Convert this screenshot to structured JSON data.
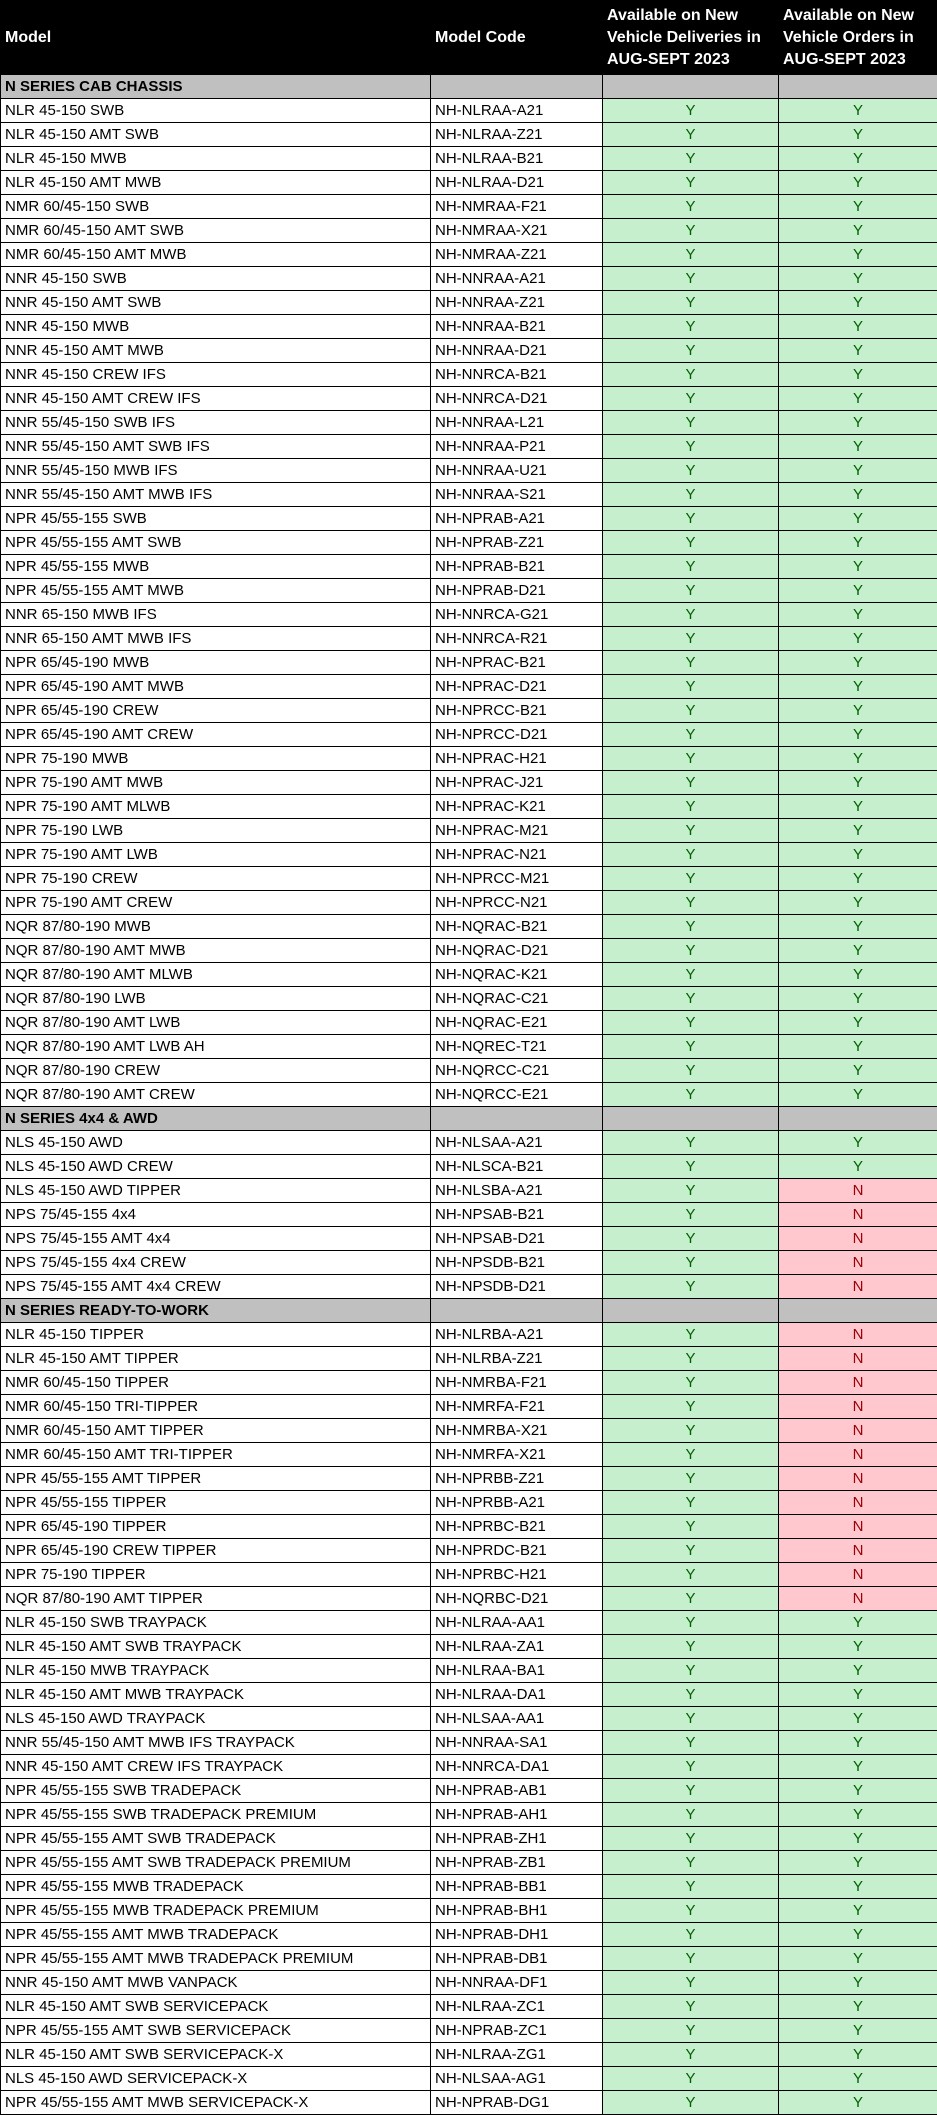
{
  "headers": {
    "model": "Model",
    "code": "Model Code",
    "deliveries": "Available on New Vehicle Deliveries in AUG-SEPT 2023",
    "orders": "Available on New Vehicle Orders in AUG-SEPT 2023"
  },
  "colors": {
    "header_bg": "#000000",
    "section_bg": "#c0c0c0",
    "yes_bg": "#c6efce",
    "yes_text": "#006100",
    "no_bg": "#ffc7ce",
    "no_text": "#9c0006"
  },
  "rows": [
    {
      "type": "section",
      "title": "N SERIES CAB CHASSIS"
    },
    {
      "type": "row",
      "model": "NLR 45-150 SWB",
      "code": "NH-NLRAA-A21",
      "deliveries": "Y",
      "orders": "Y"
    },
    {
      "type": "row",
      "model": "NLR 45-150 AMT SWB",
      "code": "NH-NLRAA-Z21",
      "deliveries": "Y",
      "orders": "Y"
    },
    {
      "type": "row",
      "model": "NLR 45-150 MWB",
      "code": "NH-NLRAA-B21",
      "deliveries": "Y",
      "orders": "Y"
    },
    {
      "type": "row",
      "model": "NLR 45-150 AMT MWB",
      "code": "NH-NLRAA-D21",
      "deliveries": "Y",
      "orders": "Y"
    },
    {
      "type": "row",
      "model": "NMR 60/45-150 SWB",
      "code": "NH-NMRAA-F21",
      "deliveries": "Y",
      "orders": "Y"
    },
    {
      "type": "row",
      "model": "NMR 60/45-150 AMT SWB",
      "code": "NH-NMRAA-X21",
      "deliveries": "Y",
      "orders": "Y"
    },
    {
      "type": "row",
      "model": "NMR 60/45-150 AMT MWB",
      "code": "NH-NMRAA-Z21",
      "deliveries": "Y",
      "orders": "Y"
    },
    {
      "type": "row",
      "model": "NNR 45-150 SWB",
      "code": "NH-NNRAA-A21",
      "deliveries": "Y",
      "orders": "Y"
    },
    {
      "type": "row",
      "model": "NNR 45-150 AMT SWB",
      "code": "NH-NNRAA-Z21",
      "deliveries": "Y",
      "orders": "Y"
    },
    {
      "type": "row",
      "model": "NNR 45-150 MWB",
      "code": "NH-NNRAA-B21",
      "deliveries": "Y",
      "orders": "Y"
    },
    {
      "type": "row",
      "model": "NNR 45-150 AMT MWB",
      "code": "NH-NNRAA-D21",
      "deliveries": "Y",
      "orders": "Y"
    },
    {
      "type": "row",
      "model": "NNR 45-150 CREW IFS",
      "code": "NH-NNRCA-B21",
      "deliveries": "Y",
      "orders": "Y"
    },
    {
      "type": "row",
      "model": "NNR 45-150 AMT CREW IFS",
      "code": "NH-NNRCA-D21",
      "deliveries": "Y",
      "orders": "Y"
    },
    {
      "type": "row",
      "model": "NNR 55/45-150 SWB IFS",
      "code": "NH-NNRAA-L21",
      "deliveries": "Y",
      "orders": "Y"
    },
    {
      "type": "row",
      "model": "NNR 55/45-150 AMT SWB IFS",
      "code": "NH-NNRAA-P21",
      "deliveries": "Y",
      "orders": "Y"
    },
    {
      "type": "row",
      "model": "NNR 55/45-150 MWB IFS",
      "code": "NH-NNRAA-U21",
      "deliveries": "Y",
      "orders": "Y"
    },
    {
      "type": "row",
      "model": "NNR 55/45-150 AMT MWB IFS",
      "code": "NH-NNRAA-S21",
      "deliveries": "Y",
      "orders": "Y"
    },
    {
      "type": "row",
      "model": "NPR 45/55-155 SWB",
      "code": "NH-NPRAB-A21",
      "deliveries": "Y",
      "orders": "Y"
    },
    {
      "type": "row",
      "model": "NPR 45/55-155 AMT SWB",
      "code": "NH-NPRAB-Z21",
      "deliveries": "Y",
      "orders": "Y"
    },
    {
      "type": "row",
      "model": "NPR 45/55-155 MWB",
      "code": "NH-NPRAB-B21",
      "deliveries": "Y",
      "orders": "Y"
    },
    {
      "type": "row",
      "model": "NPR 45/55-155 AMT MWB",
      "code": "NH-NPRAB-D21",
      "deliveries": "Y",
      "orders": "Y"
    },
    {
      "type": "row",
      "model": "NNR 65-150 MWB IFS",
      "code": "NH-NNRCA-G21",
      "deliveries": "Y",
      "orders": "Y"
    },
    {
      "type": "row",
      "model": "NNR 65-150 AMT MWB IFS",
      "code": "NH-NNRCA-R21",
      "deliveries": "Y",
      "orders": "Y"
    },
    {
      "type": "row",
      "model": "NPR 65/45-190 MWB",
      "code": "NH-NPRAC-B21",
      "deliveries": "Y",
      "orders": "Y"
    },
    {
      "type": "row",
      "model": "NPR 65/45-190 AMT MWB",
      "code": "NH-NPRAC-D21",
      "deliveries": "Y",
      "orders": "Y"
    },
    {
      "type": "row",
      "model": "NPR 65/45-190 CREW",
      "code": "NH-NPRCC-B21",
      "deliveries": "Y",
      "orders": "Y"
    },
    {
      "type": "row",
      "model": "NPR 65/45-190 AMT CREW",
      "code": "NH-NPRCC-D21",
      "deliveries": "Y",
      "orders": "Y"
    },
    {
      "type": "row",
      "model": "NPR 75-190 MWB",
      "code": "NH-NPRAC-H21",
      "deliveries": "Y",
      "orders": "Y"
    },
    {
      "type": "row",
      "model": "NPR 75-190 AMT MWB",
      "code": "NH-NPRAC-J21",
      "deliveries": "Y",
      "orders": "Y"
    },
    {
      "type": "row",
      "model": "NPR 75-190 AMT MLWB",
      "code": "NH-NPRAC-K21",
      "deliveries": "Y",
      "orders": "Y"
    },
    {
      "type": "row",
      "model": "NPR 75-190 LWB",
      "code": "NH-NPRAC-M21",
      "deliveries": "Y",
      "orders": "Y"
    },
    {
      "type": "row",
      "model": "NPR 75-190 AMT LWB",
      "code": "NH-NPRAC-N21",
      "deliveries": "Y",
      "orders": "Y"
    },
    {
      "type": "row",
      "model": "NPR 75-190 CREW",
      "code": "NH-NPRCC-M21",
      "deliveries": "Y",
      "orders": "Y"
    },
    {
      "type": "row",
      "model": "NPR 75-190 AMT CREW",
      "code": "NH-NPRCC-N21",
      "deliveries": "Y",
      "orders": "Y"
    },
    {
      "type": "row",
      "model": "NQR 87/80-190 MWB",
      "code": "NH-NQRAC-B21",
      "deliveries": "Y",
      "orders": "Y"
    },
    {
      "type": "row",
      "model": "NQR 87/80-190 AMT MWB",
      "code": "NH-NQRAC-D21",
      "deliveries": "Y",
      "orders": "Y"
    },
    {
      "type": "row",
      "model": "NQR 87/80-190 AMT MLWB",
      "code": "NH-NQRAC-K21",
      "deliveries": "Y",
      "orders": "Y"
    },
    {
      "type": "row",
      "model": "NQR 87/80-190 LWB",
      "code": "NH-NQRAC-C21",
      "deliveries": "Y",
      "orders": "Y"
    },
    {
      "type": "row",
      "model": "NQR 87/80-190 AMT LWB",
      "code": "NH-NQRAC-E21",
      "deliveries": "Y",
      "orders": "Y"
    },
    {
      "type": "row",
      "model": "NQR 87/80-190 AMT LWB AH",
      "code": "NH-NQREC-T21",
      "deliveries": "Y",
      "orders": "Y"
    },
    {
      "type": "row",
      "model": "NQR 87/80-190 CREW",
      "code": "NH-NQRCC-C21",
      "deliveries": "Y",
      "orders": "Y"
    },
    {
      "type": "row",
      "model": "NQR 87/80-190 AMT CREW",
      "code": "NH-NQRCC-E21",
      "deliveries": "Y",
      "orders": "Y"
    },
    {
      "type": "section",
      "title": "N SERIES 4x4 & AWD"
    },
    {
      "type": "row",
      "model": "NLS 45-150 AWD",
      "code": "NH-NLSAA-A21",
      "deliveries": "Y",
      "orders": "Y"
    },
    {
      "type": "row",
      "model": "NLS 45-150 AWD CREW",
      "code": "NH-NLSCA-B21",
      "deliveries": "Y",
      "orders": "Y"
    },
    {
      "type": "row",
      "model": "NLS 45-150 AWD TIPPER",
      "code": "NH-NLSBA-A21",
      "deliveries": "Y",
      "orders": "N"
    },
    {
      "type": "row",
      "model": "NPS 75/45-155 4x4",
      "code": "NH-NPSAB-B21",
      "deliveries": "Y",
      "orders": "N"
    },
    {
      "type": "row",
      "model": "NPS 75/45-155 AMT 4x4",
      "code": "NH-NPSAB-D21",
      "deliveries": "Y",
      "orders": "N"
    },
    {
      "type": "row",
      "model": "NPS 75/45-155 4x4 CREW",
      "code": "NH-NPSDB-B21",
      "deliveries": "Y",
      "orders": "N"
    },
    {
      "type": "row",
      "model": "NPS 75/45-155 AMT 4x4 CREW",
      "code": "NH-NPSDB-D21",
      "deliveries": "Y",
      "orders": "N"
    },
    {
      "type": "section",
      "title": "N SERIES READY-TO-WORK"
    },
    {
      "type": "row",
      "model": "NLR 45-150 TIPPER",
      "code": "NH-NLRBA-A21",
      "deliveries": "Y",
      "orders": "N"
    },
    {
      "type": "row",
      "model": "NLR 45-150 AMT TIPPER",
      "code": "NH-NLRBA-Z21",
      "deliveries": "Y",
      "orders": "N"
    },
    {
      "type": "row",
      "model": "NMR 60/45-150 TIPPER",
      "code": "NH-NMRBA-F21",
      "deliveries": "Y",
      "orders": "N"
    },
    {
      "type": "row",
      "model": "NMR 60/45-150 TRI-TIPPER",
      "code": "NH-NMRFA-F21",
      "deliveries": "Y",
      "orders": "N"
    },
    {
      "type": "row",
      "model": "NMR 60/45-150 AMT TIPPER",
      "code": "NH-NMRBA-X21",
      "deliveries": "Y",
      "orders": "N"
    },
    {
      "type": "row",
      "model": "NMR 60/45-150 AMT TRI-TIPPER",
      "code": "NH-NMRFA-X21",
      "deliveries": "Y",
      "orders": "N"
    },
    {
      "type": "row",
      "model": "NPR 45/55-155 AMT TIPPER",
      "code": "NH-NPRBB-Z21",
      "deliveries": "Y",
      "orders": "N"
    },
    {
      "type": "row",
      "model": "NPR 45/55-155 TIPPER",
      "code": "NH-NPRBB-A21",
      "deliveries": "Y",
      "orders": "N"
    },
    {
      "type": "row",
      "model": "NPR 65/45-190 TIPPER",
      "code": "NH-NPRBC-B21",
      "deliveries": "Y",
      "orders": "N"
    },
    {
      "type": "row",
      "model": "NPR 65/45-190 CREW TIPPER",
      "code": "NH-NPRDC-B21",
      "deliveries": "Y",
      "orders": "N"
    },
    {
      "type": "row",
      "model": "NPR 75-190 TIPPER",
      "code": "NH-NPRBC-H21",
      "deliveries": "Y",
      "orders": "N"
    },
    {
      "type": "row",
      "model": "NQR 87/80-190 AMT TIPPER",
      "code": "NH-NQRBC-D21",
      "deliveries": "Y",
      "orders": "N"
    },
    {
      "type": "row",
      "model": "NLR 45-150 SWB TRAYPACK",
      "code": "NH-NLRAA-AA1",
      "deliveries": "Y",
      "orders": "Y"
    },
    {
      "type": "row",
      "model": "NLR 45-150 AMT SWB TRAYPACK",
      "code": "NH-NLRAA-ZA1",
      "deliveries": "Y",
      "orders": "Y"
    },
    {
      "type": "row",
      "model": "NLR 45-150 MWB TRAYPACK",
      "code": "NH-NLRAA-BA1",
      "deliveries": "Y",
      "orders": "Y"
    },
    {
      "type": "row",
      "model": "NLR 45-150 AMT MWB TRAYPACK",
      "code": "NH-NLRAA-DA1",
      "deliveries": "Y",
      "orders": "Y"
    },
    {
      "type": "row",
      "model": "NLS 45-150 AWD TRAYPACK",
      "code": "NH-NLSAA-AA1",
      "deliveries": "Y",
      "orders": "Y"
    },
    {
      "type": "row",
      "model": "NNR 55/45-150 AMT MWB IFS TRAYPACK",
      "code": "NH-NNRAA-SA1",
      "deliveries": "Y",
      "orders": "Y"
    },
    {
      "type": "row",
      "model": "NNR 45-150 AMT CREW IFS TRAYPACK",
      "code": "NH-NNRCA-DA1",
      "deliveries": "Y",
      "orders": "Y"
    },
    {
      "type": "row",
      "model": "NPR 45/55-155 SWB TRADEPACK",
      "code": "NH-NPRAB-AB1",
      "deliveries": "Y",
      "orders": "Y"
    },
    {
      "type": "row",
      "model": "NPR 45/55-155 SWB TRADEPACK PREMIUM",
      "code": "NH-NPRAB-AH1",
      "deliveries": "Y",
      "orders": "Y"
    },
    {
      "type": "row",
      "model": "NPR 45/55-155 AMT SWB TRADEPACK",
      "code": "NH-NPRAB-ZH1",
      "deliveries": "Y",
      "orders": "Y"
    },
    {
      "type": "row",
      "model": "NPR 45/55-155 AMT SWB TRADEPACK PREMIUM",
      "code": "NH-NPRAB-ZB1",
      "deliveries": "Y",
      "orders": "Y"
    },
    {
      "type": "row",
      "model": "NPR 45/55-155 MWB TRADEPACK",
      "code": "NH-NPRAB-BB1",
      "deliveries": "Y",
      "orders": "Y"
    },
    {
      "type": "row",
      "model": "NPR 45/55-155 MWB TRADEPACK PREMIUM",
      "code": "NH-NPRAB-BH1",
      "deliveries": "Y",
      "orders": "Y"
    },
    {
      "type": "row",
      "model": "NPR 45/55-155 AMT MWB TRADEPACK",
      "code": "NH-NPRAB-DH1",
      "deliveries": "Y",
      "orders": "Y"
    },
    {
      "type": "row",
      "model": "NPR 45/55-155 AMT MWB TRADEPACK PREMIUM",
      "code": "NH-NPRAB-DB1",
      "deliveries": "Y",
      "orders": "Y"
    },
    {
      "type": "row",
      "model": "NNR 45-150 AMT MWB VANPACK",
      "code": "NH-NNRAA-DF1",
      "deliveries": "Y",
      "orders": "Y"
    },
    {
      "type": "row",
      "model": "NLR 45-150 AMT SWB SERVICEPACK",
      "code": "NH-NLRAA-ZC1",
      "deliveries": "Y",
      "orders": "Y"
    },
    {
      "type": "row",
      "model": "NPR 45/55-155 AMT SWB SERVICEPACK",
      "code": "NH-NPRAB-ZC1",
      "deliveries": "Y",
      "orders": "Y"
    },
    {
      "type": "row",
      "model": "NLR 45-150 AMT SWB SERVICEPACK-X",
      "code": "NH-NLRAA-ZG1",
      "deliveries": "Y",
      "orders": "Y"
    },
    {
      "type": "row",
      "model": "NLS 45-150 AWD SERVICEPACK-X",
      "code": "NH-NLSAA-AG1",
      "deliveries": "Y",
      "orders": "Y"
    },
    {
      "type": "row",
      "model": "NPR 45/55-155 AMT MWB SERVICEPACK-X",
      "code": "NH-NPRAB-DG1",
      "deliveries": "Y",
      "orders": "Y"
    }
  ]
}
